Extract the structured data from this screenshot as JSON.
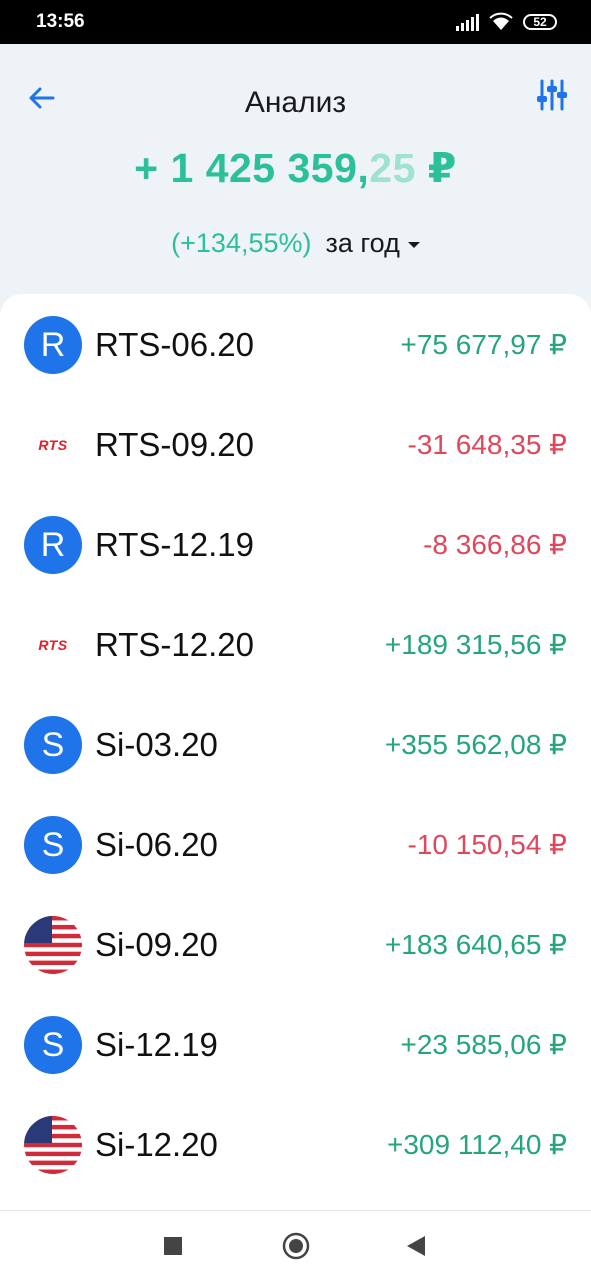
{
  "status_bar": {
    "time": "13:56",
    "battery": "52"
  },
  "header": {
    "title": "Анализ",
    "total_main": "+ 1 425 359,",
    "total_faded": "25",
    "total_currency": " ₽",
    "percent": "(+134,55%)",
    "period": "за год"
  },
  "colors": {
    "positive": "#25a57e",
    "negative": "#e0475c",
    "accent": "#1e74e8"
  },
  "instruments": [
    {
      "icon": "letter-r-circle-icon",
      "icon_letter": "R",
      "name": "RTS-06.20",
      "value": "+75 677,97 ₽",
      "sign": "pos"
    },
    {
      "icon": "rts-logo-icon",
      "icon_letter": "RTS",
      "name": "RTS-09.20",
      "value": "-31 648,35 ₽",
      "sign": "neg"
    },
    {
      "icon": "letter-r-circle-icon",
      "icon_letter": "R",
      "name": "RTS-12.19",
      "value": "-8 366,86 ₽",
      "sign": "neg"
    },
    {
      "icon": "rts-logo-icon",
      "icon_letter": "RTS",
      "name": "RTS-12.20",
      "value": "+189 315,56 ₽",
      "sign": "pos"
    },
    {
      "icon": "letter-s-circle-icon",
      "icon_letter": "S",
      "name": "Si-03.20",
      "value": "+355 562,08 ₽",
      "sign": "pos"
    },
    {
      "icon": "letter-s-circle-icon",
      "icon_letter": "S",
      "name": "Si-06.20",
      "value": "-10 150,54 ₽",
      "sign": "neg"
    },
    {
      "icon": "us-flag-icon",
      "icon_letter": "",
      "name": "Si-09.20",
      "value": "+183 640,65 ₽",
      "sign": "pos"
    },
    {
      "icon": "letter-s-circle-icon",
      "icon_letter": "S",
      "name": "Si-12.19",
      "value": "+23 585,06 ₽",
      "sign": "pos"
    },
    {
      "icon": "us-flag-icon",
      "icon_letter": "",
      "name": "Si-12.20",
      "value": "+309 112,40 ₽",
      "sign": "pos"
    }
  ]
}
